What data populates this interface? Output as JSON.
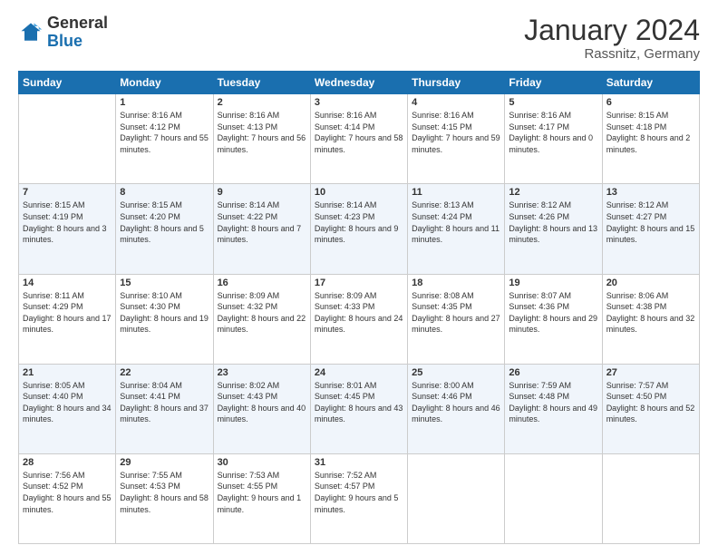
{
  "logo": {
    "general": "General",
    "blue": "Blue"
  },
  "title": {
    "month": "January 2024",
    "location": "Rassnitz, Germany"
  },
  "days": [
    "Sunday",
    "Monday",
    "Tuesday",
    "Wednesday",
    "Thursday",
    "Friday",
    "Saturday"
  ],
  "weeks": [
    [
      {
        "day": null,
        "sunrise": null,
        "sunset": null,
        "daylight": null
      },
      {
        "day": "1",
        "sunrise": "Sunrise: 8:16 AM",
        "sunset": "Sunset: 4:12 PM",
        "daylight": "Daylight: 7 hours and 55 minutes."
      },
      {
        "day": "2",
        "sunrise": "Sunrise: 8:16 AM",
        "sunset": "Sunset: 4:13 PM",
        "daylight": "Daylight: 7 hours and 56 minutes."
      },
      {
        "day": "3",
        "sunrise": "Sunrise: 8:16 AM",
        "sunset": "Sunset: 4:14 PM",
        "daylight": "Daylight: 7 hours and 58 minutes."
      },
      {
        "day": "4",
        "sunrise": "Sunrise: 8:16 AM",
        "sunset": "Sunset: 4:15 PM",
        "daylight": "Daylight: 7 hours and 59 minutes."
      },
      {
        "day": "5",
        "sunrise": "Sunrise: 8:16 AM",
        "sunset": "Sunset: 4:17 PM",
        "daylight": "Daylight: 8 hours and 0 minutes."
      },
      {
        "day": "6",
        "sunrise": "Sunrise: 8:15 AM",
        "sunset": "Sunset: 4:18 PM",
        "daylight": "Daylight: 8 hours and 2 minutes."
      }
    ],
    [
      {
        "day": "7",
        "sunrise": "Sunrise: 8:15 AM",
        "sunset": "Sunset: 4:19 PM",
        "daylight": "Daylight: 8 hours and 3 minutes."
      },
      {
        "day": "8",
        "sunrise": "Sunrise: 8:15 AM",
        "sunset": "Sunset: 4:20 PM",
        "daylight": "Daylight: 8 hours and 5 minutes."
      },
      {
        "day": "9",
        "sunrise": "Sunrise: 8:14 AM",
        "sunset": "Sunset: 4:22 PM",
        "daylight": "Daylight: 8 hours and 7 minutes."
      },
      {
        "day": "10",
        "sunrise": "Sunrise: 8:14 AM",
        "sunset": "Sunset: 4:23 PM",
        "daylight": "Daylight: 8 hours and 9 minutes."
      },
      {
        "day": "11",
        "sunrise": "Sunrise: 8:13 AM",
        "sunset": "Sunset: 4:24 PM",
        "daylight": "Daylight: 8 hours and 11 minutes."
      },
      {
        "day": "12",
        "sunrise": "Sunrise: 8:12 AM",
        "sunset": "Sunset: 4:26 PM",
        "daylight": "Daylight: 8 hours and 13 minutes."
      },
      {
        "day": "13",
        "sunrise": "Sunrise: 8:12 AM",
        "sunset": "Sunset: 4:27 PM",
        "daylight": "Daylight: 8 hours and 15 minutes."
      }
    ],
    [
      {
        "day": "14",
        "sunrise": "Sunrise: 8:11 AM",
        "sunset": "Sunset: 4:29 PM",
        "daylight": "Daylight: 8 hours and 17 minutes."
      },
      {
        "day": "15",
        "sunrise": "Sunrise: 8:10 AM",
        "sunset": "Sunset: 4:30 PM",
        "daylight": "Daylight: 8 hours and 19 minutes."
      },
      {
        "day": "16",
        "sunrise": "Sunrise: 8:09 AM",
        "sunset": "Sunset: 4:32 PM",
        "daylight": "Daylight: 8 hours and 22 minutes."
      },
      {
        "day": "17",
        "sunrise": "Sunrise: 8:09 AM",
        "sunset": "Sunset: 4:33 PM",
        "daylight": "Daylight: 8 hours and 24 minutes."
      },
      {
        "day": "18",
        "sunrise": "Sunrise: 8:08 AM",
        "sunset": "Sunset: 4:35 PM",
        "daylight": "Daylight: 8 hours and 27 minutes."
      },
      {
        "day": "19",
        "sunrise": "Sunrise: 8:07 AM",
        "sunset": "Sunset: 4:36 PM",
        "daylight": "Daylight: 8 hours and 29 minutes."
      },
      {
        "day": "20",
        "sunrise": "Sunrise: 8:06 AM",
        "sunset": "Sunset: 4:38 PM",
        "daylight": "Daylight: 8 hours and 32 minutes."
      }
    ],
    [
      {
        "day": "21",
        "sunrise": "Sunrise: 8:05 AM",
        "sunset": "Sunset: 4:40 PM",
        "daylight": "Daylight: 8 hours and 34 minutes."
      },
      {
        "day": "22",
        "sunrise": "Sunrise: 8:04 AM",
        "sunset": "Sunset: 4:41 PM",
        "daylight": "Daylight: 8 hours and 37 minutes."
      },
      {
        "day": "23",
        "sunrise": "Sunrise: 8:02 AM",
        "sunset": "Sunset: 4:43 PM",
        "daylight": "Daylight: 8 hours and 40 minutes."
      },
      {
        "day": "24",
        "sunrise": "Sunrise: 8:01 AM",
        "sunset": "Sunset: 4:45 PM",
        "daylight": "Daylight: 8 hours and 43 minutes."
      },
      {
        "day": "25",
        "sunrise": "Sunrise: 8:00 AM",
        "sunset": "Sunset: 4:46 PM",
        "daylight": "Daylight: 8 hours and 46 minutes."
      },
      {
        "day": "26",
        "sunrise": "Sunrise: 7:59 AM",
        "sunset": "Sunset: 4:48 PM",
        "daylight": "Daylight: 8 hours and 49 minutes."
      },
      {
        "day": "27",
        "sunrise": "Sunrise: 7:57 AM",
        "sunset": "Sunset: 4:50 PM",
        "daylight": "Daylight: 8 hours and 52 minutes."
      }
    ],
    [
      {
        "day": "28",
        "sunrise": "Sunrise: 7:56 AM",
        "sunset": "Sunset: 4:52 PM",
        "daylight": "Daylight: 8 hours and 55 minutes."
      },
      {
        "day": "29",
        "sunrise": "Sunrise: 7:55 AM",
        "sunset": "Sunset: 4:53 PM",
        "daylight": "Daylight: 8 hours and 58 minutes."
      },
      {
        "day": "30",
        "sunrise": "Sunrise: 7:53 AM",
        "sunset": "Sunset: 4:55 PM",
        "daylight": "Daylight: 9 hours and 1 minute."
      },
      {
        "day": "31",
        "sunrise": "Sunrise: 7:52 AM",
        "sunset": "Sunset: 4:57 PM",
        "daylight": "Daylight: 9 hours and 5 minutes."
      },
      {
        "day": null,
        "sunrise": null,
        "sunset": null,
        "daylight": null
      },
      {
        "day": null,
        "sunrise": null,
        "sunset": null,
        "daylight": null
      },
      {
        "day": null,
        "sunrise": null,
        "sunset": null,
        "daylight": null
      }
    ]
  ]
}
